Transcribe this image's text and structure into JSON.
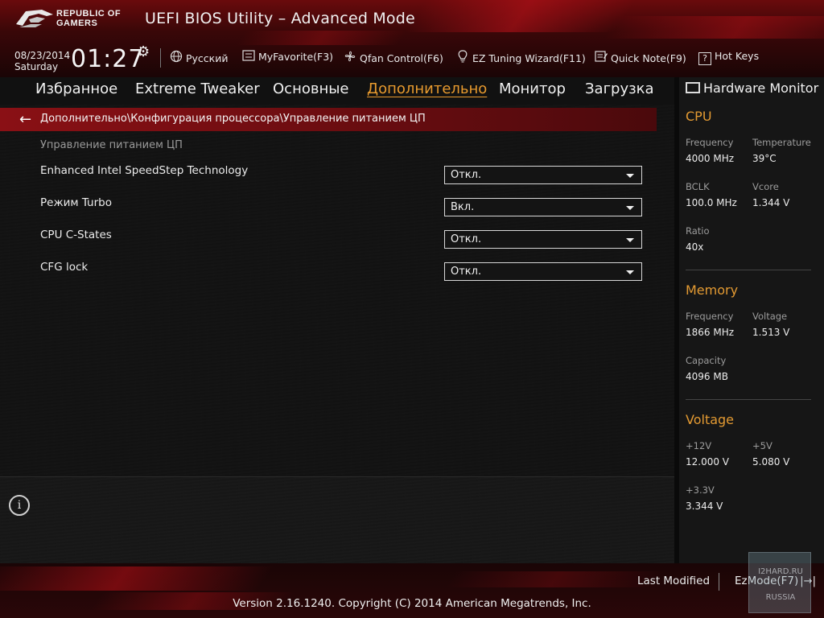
{
  "header": {
    "brand": "REPUBLIC OF GAMERS",
    "title": "UEFI BIOS Utility – Advanced Mode",
    "date": "08/23/2014",
    "day": "Saturday",
    "time": "01:27"
  },
  "toolbar": {
    "language": "Русский",
    "myfavorite": "MyFavorite(F3)",
    "qfan": "Qfan Control(F6)",
    "ez_tuning": "EZ Tuning Wizard(F11)",
    "quick_note": "Quick Note(F9)",
    "hot_keys": "Hot Keys",
    "hot_keys_glyph": "?"
  },
  "tabs": [
    {
      "label": "Избранное",
      "active": false
    },
    {
      "label": "Extreme Tweaker",
      "active": false
    },
    {
      "label": "Основные",
      "active": false
    },
    {
      "label": "Дополнительно",
      "active": true
    },
    {
      "label": "Монитор",
      "active": false
    },
    {
      "label": "Загрузка",
      "active": false
    }
  ],
  "breadcrumb": "Дополнительно\\Конфигурация процессора\\Управление питанием ЦП",
  "section_title": "Управление питанием ЦП",
  "settings": [
    {
      "label": "Enhanced Intel SpeedStep Technology",
      "value": "Откл."
    },
    {
      "label": "Режим Turbo",
      "value": "Вкл."
    },
    {
      "label": "CPU C-States",
      "value": "Откл."
    },
    {
      "label": "CFG lock",
      "value": "Откл."
    }
  ],
  "help_icon": "i",
  "hardware_monitor": {
    "title": "Hardware Monitor",
    "cpu": {
      "title": "CPU",
      "frequency_label": "Frequency",
      "frequency": "4000 MHz",
      "temperature_label": "Temperature",
      "temperature": "39°C",
      "bclk_label": "BCLK",
      "bclk": "100.0 MHz",
      "vcore_label": "Vcore",
      "vcore": "1.344 V",
      "ratio_label": "Ratio",
      "ratio": "40x"
    },
    "memory": {
      "title": "Memory",
      "frequency_label": "Frequency",
      "frequency": "1866 MHz",
      "voltage_label": "Voltage",
      "voltage": "1.513 V",
      "capacity_label": "Capacity",
      "capacity": "4096 MB"
    },
    "voltage": {
      "title": "Voltage",
      "v12_label": "+12V",
      "v12": "12.000 V",
      "v5_label": "+5V",
      "v5": "5.080 V",
      "v33_label": "+3.3V",
      "v33": "3.344 V"
    }
  },
  "footer": {
    "last_modified": "Last Modified",
    "ezmode": "EzMode(F7)",
    "ezmode_glyph": "|→|",
    "version": "Version 2.16.1240. Copyright (C) 2014 American Megatrends, Inc."
  },
  "watermark": {
    "site": "I2HARD.RU",
    "region": "RUSSIA"
  },
  "colors": {
    "accent": "#e39a32",
    "brand_red": "#a80f15"
  }
}
